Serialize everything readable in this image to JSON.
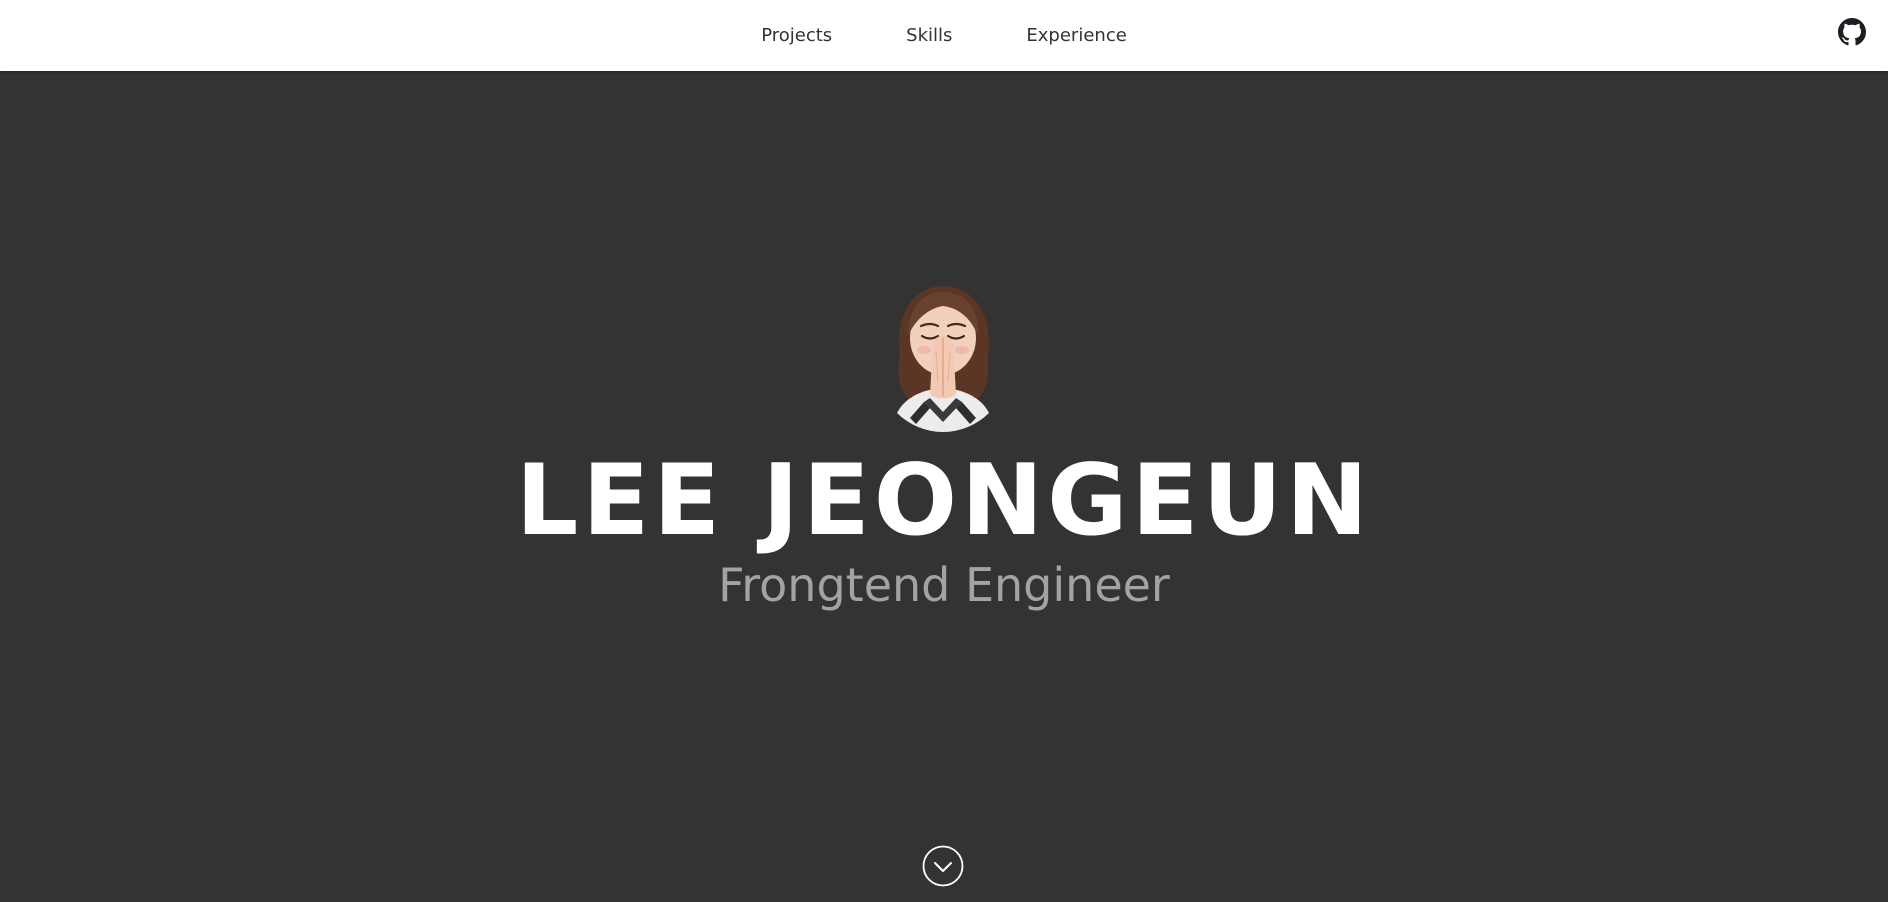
{
  "nav": {
    "links": [
      {
        "label": "Projects"
      },
      {
        "label": "Skills"
      },
      {
        "label": "Experience"
      }
    ],
    "github_icon": "github-icon"
  },
  "hero": {
    "avatar_icon": "memoji-avatar",
    "name": "LEE JEONGEUN",
    "role": "Frongtend Engineer",
    "scroll_icon": "chevron-down-circle-icon"
  },
  "colors": {
    "nav_background": "#ffffff",
    "hero_background": "#333333",
    "name_text": "#ffffff",
    "role_text": "#a3a3a3",
    "nav_text": "#333333"
  }
}
